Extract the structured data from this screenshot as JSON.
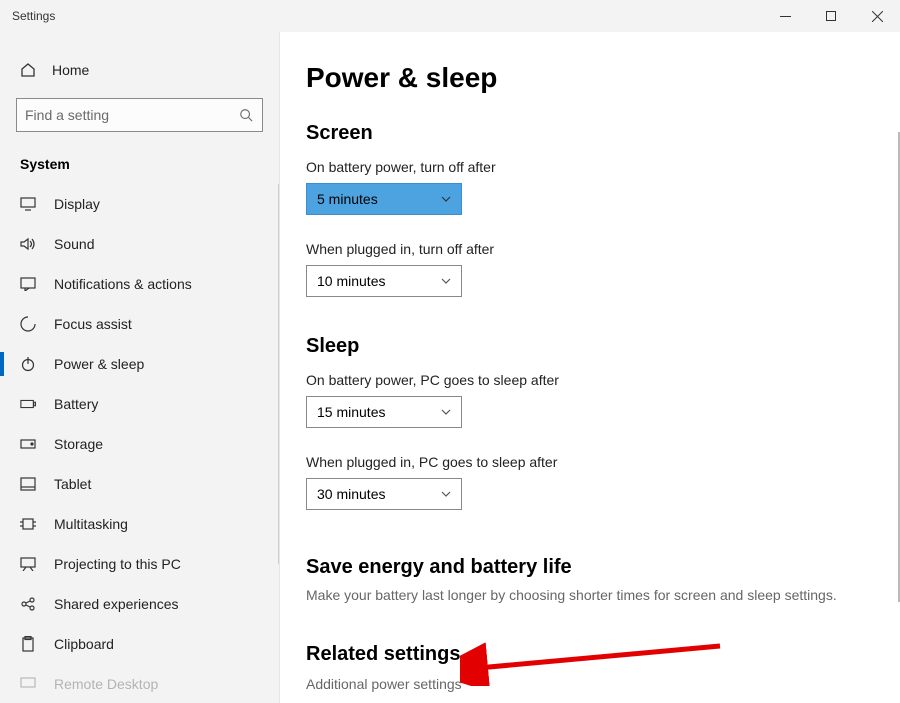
{
  "window": {
    "title": "Settings"
  },
  "sidebar": {
    "home": "Home",
    "search_placeholder": "Find a setting",
    "category": "System",
    "items": [
      {
        "label": "Display"
      },
      {
        "label": "Sound"
      },
      {
        "label": "Notifications & actions"
      },
      {
        "label": "Focus assist"
      },
      {
        "label": "Power & sleep"
      },
      {
        "label": "Battery"
      },
      {
        "label": "Storage"
      },
      {
        "label": "Tablet"
      },
      {
        "label": "Multitasking"
      },
      {
        "label": "Projecting to this PC"
      },
      {
        "label": "Shared experiences"
      },
      {
        "label": "Clipboard"
      },
      {
        "label": "Remote Desktop"
      }
    ]
  },
  "main": {
    "title": "Power & sleep",
    "screen": {
      "heading": "Screen",
      "battery_label": "On battery power, turn off after",
      "battery_value": "5 minutes",
      "plugged_label": "When plugged in, turn off after",
      "plugged_value": "10 minutes"
    },
    "sleep": {
      "heading": "Sleep",
      "battery_label": "On battery power, PC goes to sleep after",
      "battery_value": "15 minutes",
      "plugged_label": "When plugged in, PC goes to sleep after",
      "plugged_value": "30 minutes"
    },
    "save": {
      "heading": "Save energy and battery life",
      "sub": "Make your battery last longer by choosing shorter times for screen and sleep settings."
    },
    "related": {
      "heading": "Related settings",
      "link": "Additional power settings"
    }
  }
}
